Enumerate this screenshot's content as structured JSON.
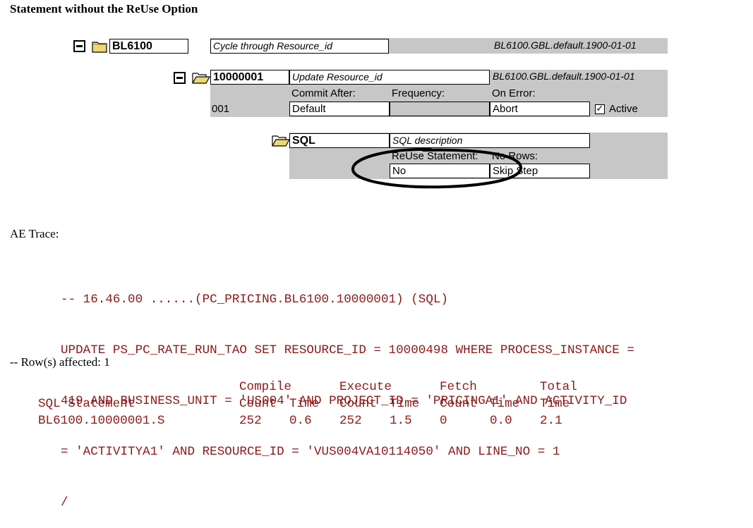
{
  "page_title": "Statement without the ReUse Option",
  "tree": {
    "section_name": "BL6100",
    "section_desc": "Cycle through Resource_id",
    "section_meta": "BL6100.GBL.default.1900-01-01",
    "step_name": "10000001",
    "step_desc": "Update Resource_id",
    "step_meta": "BL6100.GBL.default.1900-01-01",
    "commit_after_label": "Commit After:",
    "frequency_label": "Frequency:",
    "on_error_label": "On Error:",
    "step_number": "001",
    "commit_after_value": "Default",
    "frequency_value": "",
    "on_error_value": "Abort",
    "active_label": "Active",
    "active_checked": true,
    "action_name": "SQL",
    "action_desc": "SQL description",
    "reuse_label": "ReUse Statement:",
    "no_rows_label": "No Rows:",
    "reuse_value": "No",
    "no_rows_value": "Skip Step"
  },
  "ae_trace_label": "AE Trace:",
  "trace_lines": [
    "-- 16.46.00 ......(PC_PRICING.BL6100.10000001) (SQL)",
    "UPDATE PS_PC_RATE_RUN_TAO SET RESOURCE_ID = 10000498 WHERE PROCESS_INSTANCE =",
    "419 AND BUSINESS_UNIT = 'US004' AND PROJECT_ID = 'PRICINGA1' AND ACTIVITY_ID",
    "= 'ACTIVITYA1' AND RESOURCE_ID = 'VUS004VA10114050' AND LINE_NO = 1",
    "/"
  ],
  "rows_affected": "-- Row(s) affected: 1",
  "stats": {
    "header_compile": "Compile",
    "header_execute": "Execute",
    "header_fetch": "Fetch",
    "header_total": "Total",
    "col_sql_statement": "SQL Statement",
    "col_count": "Count",
    "col_time": "Time",
    "row_statement": "BL6100.10000001.S",
    "compile_count": "252",
    "compile_time": "0.6",
    "execute_count": "252",
    "execute_time": "1.5",
    "fetch_count": "0",
    "fetch_time": "0.0",
    "total_time": "2.1"
  },
  "colors": {
    "trace_text": "#8b1a1a",
    "panel_gray": "#c7c7c7",
    "folder": "#f0d870"
  },
  "icons": [
    "minus-icon",
    "folder-icon",
    "open-folder-icon",
    "checkbox-icon"
  ]
}
